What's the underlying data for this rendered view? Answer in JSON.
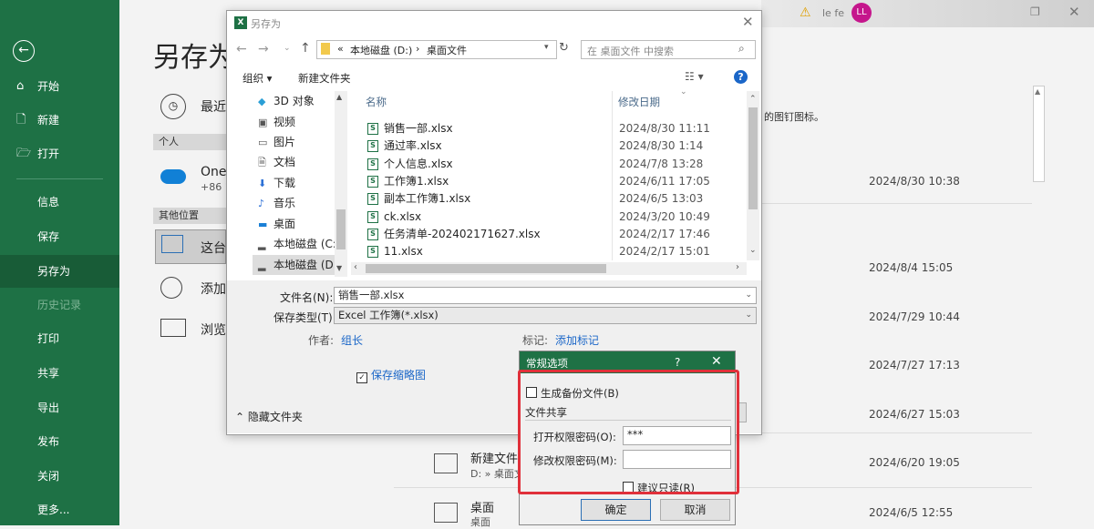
{
  "topbar": {
    "user_name": "le fe",
    "avatar_initials": "LL"
  },
  "nav": {
    "items": [
      {
        "label": "开始",
        "icon": "home-icon"
      },
      {
        "label": "新建",
        "icon": "new-document-icon"
      },
      {
        "label": "打开",
        "icon": "open-folder-icon"
      },
      {
        "label": "信息"
      },
      {
        "label": "保存"
      },
      {
        "label": "另存为"
      },
      {
        "label": "历史记录"
      },
      {
        "label": "打印"
      },
      {
        "label": "共享"
      },
      {
        "label": "导出"
      },
      {
        "label": "发布"
      },
      {
        "label": "关闭"
      },
      {
        "label": "更多..."
      }
    ],
    "selected": "另存为"
  },
  "backstage": {
    "title": "另存为",
    "recent_label": "最近",
    "personal_section": "个人",
    "onedrive_label": "One",
    "onedrive_sub": "+86 1",
    "other_section": "其他位置",
    "this_pc": "这台",
    "add_location": "添加",
    "browse": "浏览",
    "pin_hint": "的图钉图标。",
    "dates": [
      "2024/8/30 10:38",
      "2024/8/4 15:05",
      "2024/7/29 10:44",
      "2024/7/27 17:13",
      "2024/6/27 15:03",
      "2024/6/20 19:05",
      "2024/6/5 12:55"
    ],
    "folder1_name": "新建文件",
    "folder1_path": "D: » 桌面文",
    "folder2_name": "桌面",
    "folder2_path": "桌面"
  },
  "dialog": {
    "title": "另存为",
    "breadcrumb": [
      "«",
      "本地磁盘 (D:)",
      "›",
      "桌面文件"
    ],
    "search_placeholder": "在 桌面文件 中搜索",
    "organize": "组织 ▾",
    "new_folder": "新建文件夹",
    "tree": [
      {
        "label": "3D 对象",
        "icon": "3d-objects-icon"
      },
      {
        "label": "视频",
        "icon": "video-icon"
      },
      {
        "label": "图片",
        "icon": "pictures-icon"
      },
      {
        "label": "文档",
        "icon": "documents-icon"
      },
      {
        "label": "下载",
        "icon": "download-icon"
      },
      {
        "label": "音乐",
        "icon": "music-icon"
      },
      {
        "label": "桌面",
        "icon": "desktop-icon"
      },
      {
        "label": "本地磁盘 (C:)",
        "icon": "drive-icon"
      },
      {
        "label": "本地磁盘 (D:)",
        "icon": "drive-icon"
      }
    ],
    "col_name": "名称",
    "col_date": "修改日期",
    "files": [
      {
        "name": "销售一部.xlsx",
        "date": "2024/8/30 11:11"
      },
      {
        "name": "通过率.xlsx",
        "date": "2024/8/30 1:14"
      },
      {
        "name": "个人信息.xlsx",
        "date": "2024/7/8 13:28"
      },
      {
        "name": "工作簿1.xlsx",
        "date": "2024/6/11 17:05"
      },
      {
        "name": "副本工作簿1.xlsx",
        "date": "2024/6/5 13:03"
      },
      {
        "name": "ck.xlsx",
        "date": "2024/3/20 10:49"
      },
      {
        "name": "任务清单-202402171627.xlsx",
        "date": "2024/2/17 17:46"
      },
      {
        "name": "11.xlsx",
        "date": "2024/2/17 15:01"
      }
    ],
    "filename_label": "文件名(N):",
    "filename_value": "销售一部.xlsx",
    "filetype_label": "保存类型(T):",
    "filetype_value": "Excel 工作簿(*.xlsx)",
    "author_label": "作者:",
    "author_value": "组长",
    "tags_label": "标记:",
    "tags_value": "添加标记",
    "thumbnail_label": "保存缩略图",
    "hide_folders": "隐藏文件夹"
  },
  "general_options": {
    "title": "常规选项",
    "help": "?",
    "backup_label": "生成备份文件(B)",
    "share_section": "文件共享",
    "open_pwd_label": "打开权限密码(O):",
    "open_pwd_value": "***",
    "modify_pwd_label": "修改权限密码(M):",
    "modify_pwd_value": "",
    "readonly_label": "建议只读(R)",
    "ok": "确定",
    "cancel": "取消"
  },
  "colors": {
    "excel_green": "#1e7145",
    "highlight_red": "#e0303a"
  }
}
